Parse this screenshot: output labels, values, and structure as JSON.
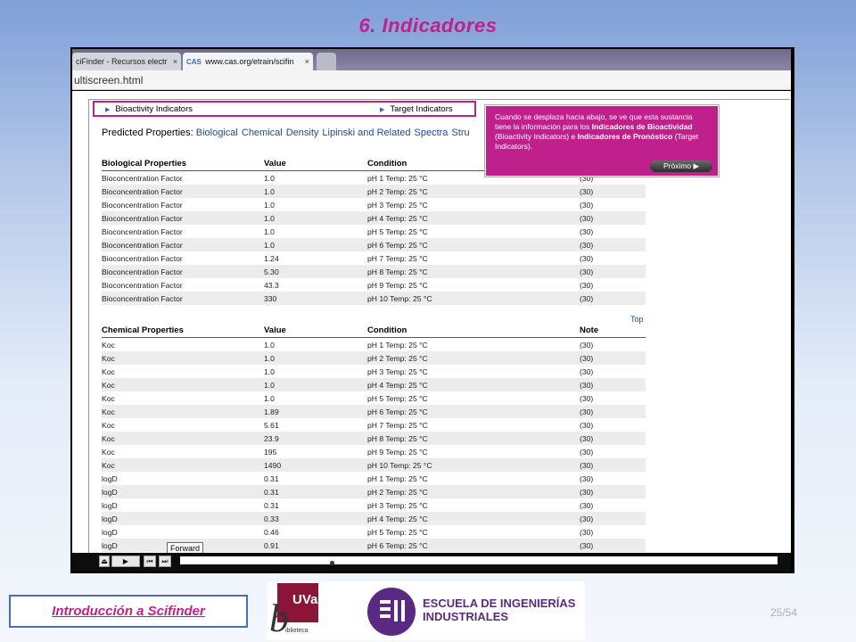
{
  "slide": {
    "title": "6. Indicadores",
    "footer_label": "Introducción a Scifinder",
    "page_number": "25/54"
  },
  "browser": {
    "tabs": [
      {
        "label": "ciFinder - Recursos electr",
        "close": "×"
      },
      {
        "label": "www.cas.org/etrain/scifin",
        "close": "×",
        "icon_text": "CAS"
      }
    ],
    "address": "ultiscreen.html"
  },
  "indicators": {
    "bioactivity": "Bioactivity Indicators",
    "target": "Target Indicators"
  },
  "predicted": {
    "label": "Predicted Properties:",
    "links": [
      "Biological",
      "Chemical",
      "Density",
      "Lipinski and Related",
      "Spectra",
      "Stru"
    ]
  },
  "tooltip": {
    "text_1": "Cuando se desplaza hacia abajo, se ve que esta sustancia tiene la información para los ",
    "bold_1": "Indicadores de Bioactividad",
    "text_2": " (Bioactivity Indicators) e ",
    "bold_2": "Indicadores de Pronóstico",
    "text_3": " (Target Indicators).",
    "next_label": "Próximo ▶"
  },
  "biological_table": {
    "headers": [
      "Biological Properties",
      "Value",
      "Condition",
      ""
    ],
    "rows": [
      [
        "Bioconcentration Factor",
        "1.0",
        "pH 1 Temp: 25 °C",
        "(30)"
      ],
      [
        "Bioconcentration Factor",
        "1.0",
        "pH 2 Temp: 25 °C",
        "(30)"
      ],
      [
        "Bioconcentration Factor",
        "1.0",
        "pH 3 Temp: 25 °C",
        "(30)"
      ],
      [
        "Bioconcentration Factor",
        "1.0",
        "pH 4 Temp: 25 °C",
        "(30)"
      ],
      [
        "Bioconcentration Factor",
        "1.0",
        "pH 5 Temp: 25 °C",
        "(30)"
      ],
      [
        "Bioconcentration Factor",
        "1.0",
        "pH 6 Temp: 25 °C",
        "(30)"
      ],
      [
        "Bioconcentration Factor",
        "1.24",
        "pH 7 Temp: 25 °C",
        "(30)"
      ],
      [
        "Bioconcentration Factor",
        "5.30",
        "pH 8 Temp: 25 °C",
        "(30)"
      ],
      [
        "Bioconcentration Factor",
        "43.3",
        "pH 9 Temp: 25 °C",
        "(30)"
      ],
      [
        "Bioconcentration Factor",
        "330",
        "pH 10 Temp: 25 °C",
        "(30)"
      ]
    ]
  },
  "top_link": "Top",
  "chemical_table": {
    "headers": [
      "Chemical Properties",
      "Value",
      "Condition",
      "Note"
    ],
    "rows": [
      [
        "Koc",
        "1.0",
        "pH 1 Temp: 25 °C",
        "(30)"
      ],
      [
        "Koc",
        "1.0",
        "pH 2 Temp: 25 °C",
        "(30)"
      ],
      [
        "Koc",
        "1.0",
        "pH 3 Temp: 25 °C",
        "(30)"
      ],
      [
        "Koc",
        "1.0",
        "pH 4 Temp: 25 °C",
        "(30)"
      ],
      [
        "Koc",
        "1.0",
        "pH 5 Temp: 25 °C",
        "(30)"
      ],
      [
        "Koc",
        "1.89",
        "pH 6 Temp: 25 °C",
        "(30)"
      ],
      [
        "Koc",
        "5.61",
        "pH 7 Temp: 25 °C",
        "(30)"
      ],
      [
        "Koc",
        "23.9",
        "pH 8 Temp: 25 °C",
        "(30)"
      ],
      [
        "Koc",
        "195",
        "pH 9 Temp: 25 °C",
        "(30)"
      ],
      [
        "Koc",
        "1490",
        "pH 10 Temp: 25 °C",
        "(30)"
      ],
      [
        "logD",
        "0.31",
        "pH 1 Temp: 25 °C",
        "(30)"
      ],
      [
        "logD",
        "0.31",
        "pH 2 Temp: 25 °C",
        "(30)"
      ],
      [
        "logD",
        "0.31",
        "pH 3 Temp: 25 °C",
        "(30)"
      ],
      [
        "logD",
        "0.33",
        "pH 4 Temp: 25 °C",
        "(30)"
      ],
      [
        "logD",
        "0.46",
        "pH 5 Temp: 25 °C",
        "(30)"
      ],
      [
        "logD",
        "0.91",
        "pH 6 Temp: 25 °C",
        "(30)"
      ]
    ]
  },
  "player": {
    "tooltip": "Forward",
    "progress": 0.25
  },
  "logos": {
    "uva_text": "UVa",
    "uva_b": "b",
    "uva_sub": "iblioteca",
    "eii_line1": "ESCUELA DE INGENIERÍAS",
    "eii_line2": "INDUSTRIALES"
  },
  "colors": {
    "accent": "#c0208c",
    "link": "#1a4a9a",
    "eii_purple": "#5a2a82",
    "uva_red": "#8a1538"
  }
}
